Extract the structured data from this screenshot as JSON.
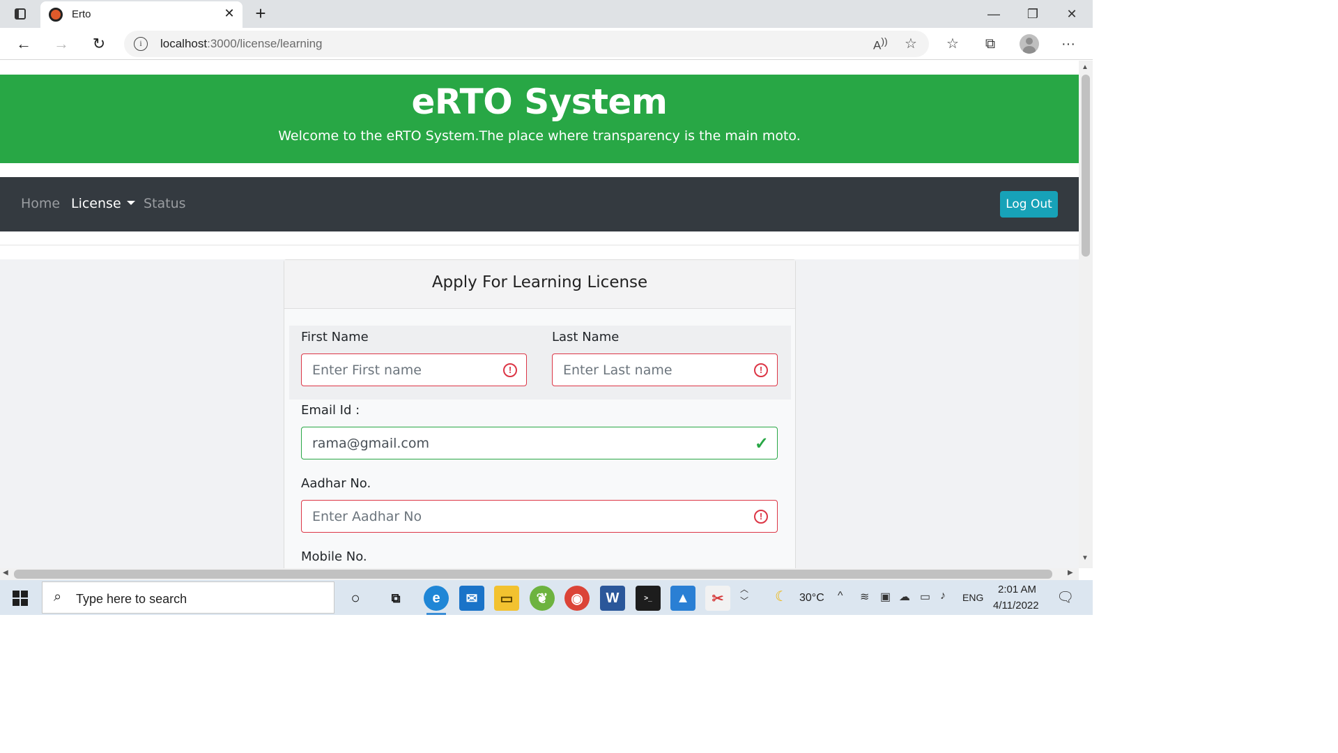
{
  "browser": {
    "tab_title": "Erto",
    "url_host": "localhost",
    "url_path": ":3000/license/learning"
  },
  "header": {
    "title": "eRTO System",
    "subtitle": "Welcome to the eRTO System.The place where transparency is the main moto."
  },
  "navbar": {
    "home": "Home",
    "license": "License",
    "status": "Status",
    "logout": "Log Out"
  },
  "form": {
    "title": "Apply For Learning License",
    "first_name_label": "First Name",
    "first_name_placeholder": "Enter First name",
    "last_name_label": "Last Name",
    "last_name_placeholder": "Enter Last name",
    "email_label": "Email Id :",
    "email_value": "rama@gmail.com",
    "aadhar_label": "Aadhar No.",
    "aadhar_placeholder": "Enter Aadhar No",
    "mobile_label": "Mobile No."
  },
  "taskbar": {
    "search_placeholder": "Type here to search",
    "weather": "30°C",
    "language": "ENG",
    "time": "2:01 AM",
    "date": "4/11/2022"
  },
  "colors": {
    "header_green": "#28a745",
    "navbar_dark": "#343a40",
    "logout_info": "#17a2b8",
    "invalid_red": "#dc3545",
    "valid_green": "#28a745"
  }
}
